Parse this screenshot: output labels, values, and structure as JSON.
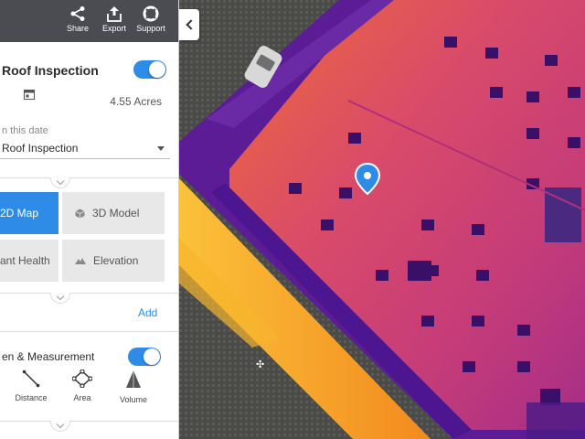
{
  "toolbar": {
    "share_label": "Share",
    "export_label": "Export",
    "support_label": "Support"
  },
  "project": {
    "title": "Roof Inspection",
    "area": "4.55 Acres",
    "visible": true
  },
  "date_picker": {
    "label": "n this date",
    "selected": "Roof Inspection"
  },
  "views": {
    "map_2d": "2D Map",
    "model_3d": "3D Model",
    "plant_health": "ant Health",
    "elevation": "Elevation",
    "active": "2D Map"
  },
  "add_label": "Add",
  "measurement": {
    "label": "en & Measurement",
    "enabled": true,
    "tools": {
      "distance": "Distance",
      "area": "Area",
      "volume": "Volume"
    }
  },
  "colors": {
    "accent": "#2e8ce6",
    "toolbar": "#4a4c52",
    "thermal_hot": "#f4a21d",
    "thermal_mid": "#e04e63",
    "thermal_cool": "#6b1fa0"
  }
}
